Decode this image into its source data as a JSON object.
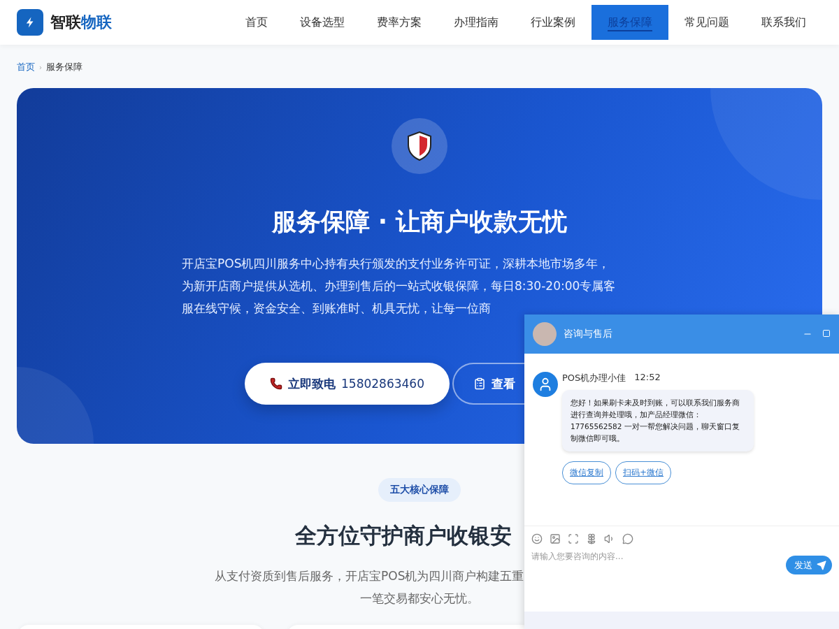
{
  "logo": {
    "text_main": "智联",
    "text_accent": "物联"
  },
  "nav": [
    {
      "label": "首页",
      "selected": false
    },
    {
      "label": "设备选型",
      "selected": false
    },
    {
      "label": "费率方案",
      "selected": false
    },
    {
      "label": "办理指南",
      "selected": false
    },
    {
      "label": "行业案例",
      "selected": false
    },
    {
      "label": "服务保障",
      "selected": true
    },
    {
      "label": "常见问题",
      "selected": false
    },
    {
      "label": "联系我们",
      "selected": false
    }
  ],
  "breadcrumb": [
    {
      "label": "首页",
      "kind": "link"
    },
    {
      "label": "›",
      "kind": "separator"
    },
    {
      "label": "服务保障",
      "kind": "current"
    }
  ],
  "hero": {
    "title": "服务保障 · 让商户收款无忧",
    "lines": [
      "开店宝POS机四川服务中心持有央行颁发的支付业务许可证，深耕本地市场多年，",
      "为新开店商户提供从选机、办理到售后的一站式收银保障，每日8:30-20:00专属客",
      "服在线守候，资金安全、到账准时、机具无忧，让每一位商"
    ],
    "buttons": [
      {
        "kind": "primary",
        "label": "立即致电",
        "value": "15802863460"
      },
      {
        "kind": "outline",
        "label": "查看"
      }
    ]
  },
  "section": {
    "badge": "五大核心保障",
    "title": "全方位守护商户收银安",
    "lines": [
      "从支付资质到售后服务，开店宝POS机为四川商户构建五重",
      "一笔交易都安心无忧。"
    ]
  },
  "chat": {
    "title": "咨询与售后",
    "message": {
      "sender": "POS机办理小佳",
      "time": "12:52",
      "text": "您好！如果刷卡未及时到账，可以联系我们服务商进行查询并处理哦，加产品经理微信：17765562582 一对一帮您解决问题，聊天窗口复制微信即可哦。"
    },
    "actions": [
      "微信复制",
      "扫码+微信"
    ],
    "input": {
      "placeholder": "请输入您要咨询的内容..."
    },
    "send": "发送"
  }
}
